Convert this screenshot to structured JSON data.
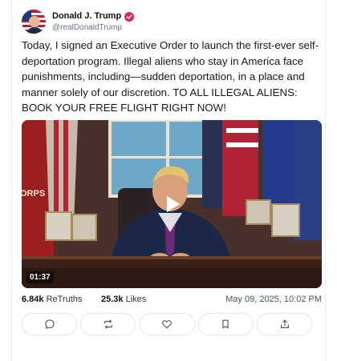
{
  "author": {
    "name": "Donald J. Trump",
    "handle": "@realDonaldTrump",
    "verified": true
  },
  "post": {
    "text": "Today, I signed an Executive Order to launch the first-ever self-deportation program. Illegal aliens who stay in America face punishments, including—sudden deportation, in a place and manner solely of our discretion. TO ALL ILLEGAL ALIENS: BOOK YOUR FREE FLIGHT RIGHT NOW!"
  },
  "video": {
    "duration": "01:37",
    "flag_text": "ORPS"
  },
  "stats": {
    "retruths_count": "6.84k",
    "retruths_label": "ReTruths",
    "likes_count": "25.3k",
    "likes_label": "Likes",
    "timestamp": "May 09, 2025, 10:02 PM"
  },
  "actions": [
    "reply-icon",
    "retruth-icon",
    "like-icon",
    "bookmark-icon",
    "share-icon"
  ],
  "colors": {
    "verified_badge": "#e0245e",
    "accent_text": "#16181c",
    "muted_text": "#6b7280"
  }
}
